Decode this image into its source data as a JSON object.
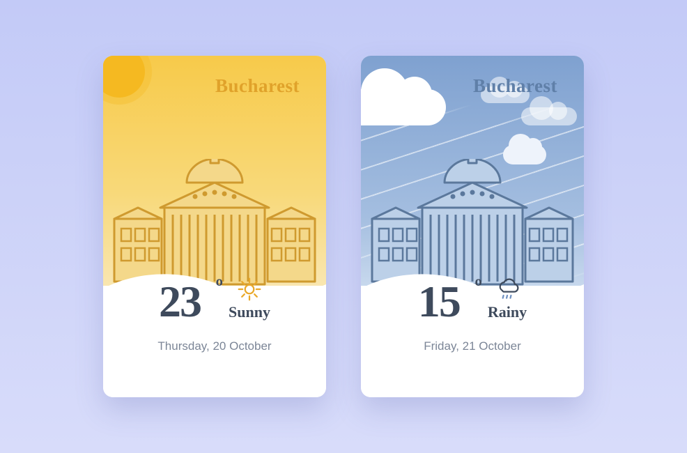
{
  "cards": [
    {
      "city": "Bucharest",
      "temperature": "23",
      "condition": "Sunny",
      "date": "Thursday, 20 October",
      "theme": "sunny",
      "colors": {
        "sky_top": "#f7ca4a",
        "accent": "#e0a22a"
      }
    },
    {
      "city": "Bucharest",
      "temperature": "15",
      "condition": "Rainy",
      "date": "Friday, 21 October",
      "theme": "rainy",
      "colors": {
        "sky_top": "#7fa1d0",
        "accent": "#5f7fa8"
      }
    }
  ]
}
